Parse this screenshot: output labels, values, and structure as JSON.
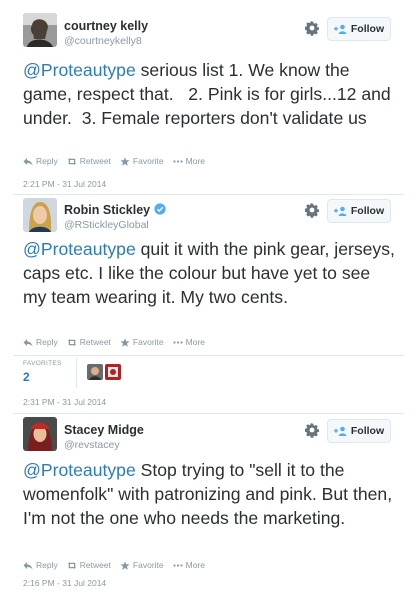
{
  "tweets": [
    {
      "name": "courtney kelly",
      "handle": "@courtneykelly8",
      "follow_label": "Follow",
      "mention": "@Proteautype",
      "text": " serious list 1. We know the game, respect that.   2. Pink is for girls...12 and under.  3. Female reporters don't validate us",
      "actions": {
        "reply": "Reply",
        "retweet": "Retweet",
        "favorite": "Favorite",
        "more": "More"
      },
      "timestamp": "2:21 PM - 31 Jul 2014"
    },
    {
      "name": "Robin Stickley",
      "handle": "@RStickleyGlobal",
      "verified": true,
      "follow_label": "Follow",
      "mention": "@Proteautype",
      "text": " quit it with the pink gear, jerseys, caps etc. I like the colour but have yet to see my team wearing it. My two cents.",
      "actions": {
        "reply": "Reply",
        "retweet": "Retweet",
        "favorite": "Favorite",
        "more": "More"
      },
      "favorites_label": "FAVORITES",
      "favorites_count": "2",
      "timestamp": "2:31 PM - 31 Jul 2014"
    },
    {
      "name": "Stacey Midge",
      "handle": "@revstacey",
      "follow_label": "Follow",
      "mention": "@Proteautype",
      "text": " Stop trying to \"sell it to the womenfolk\" with patronizing and pink. But then, I'm not the one who needs the marketing.",
      "actions": {
        "reply": "Reply",
        "retweet": "Retweet",
        "favorite": "Favorite",
        "more": "More"
      },
      "timestamp": "2:16 PM - 31 Jul 2014"
    }
  ],
  "colors": {
    "link": "#2b7bb9",
    "text": "#292f33",
    "muted": "#8899a6",
    "border": "#e1e8ed",
    "verified": "#55acee"
  },
  "icons": [
    "gear-icon",
    "follow-person-icon",
    "reply-icon",
    "retweet-icon",
    "favorite-star-icon",
    "more-dots-icon",
    "verified-badge-icon"
  ]
}
